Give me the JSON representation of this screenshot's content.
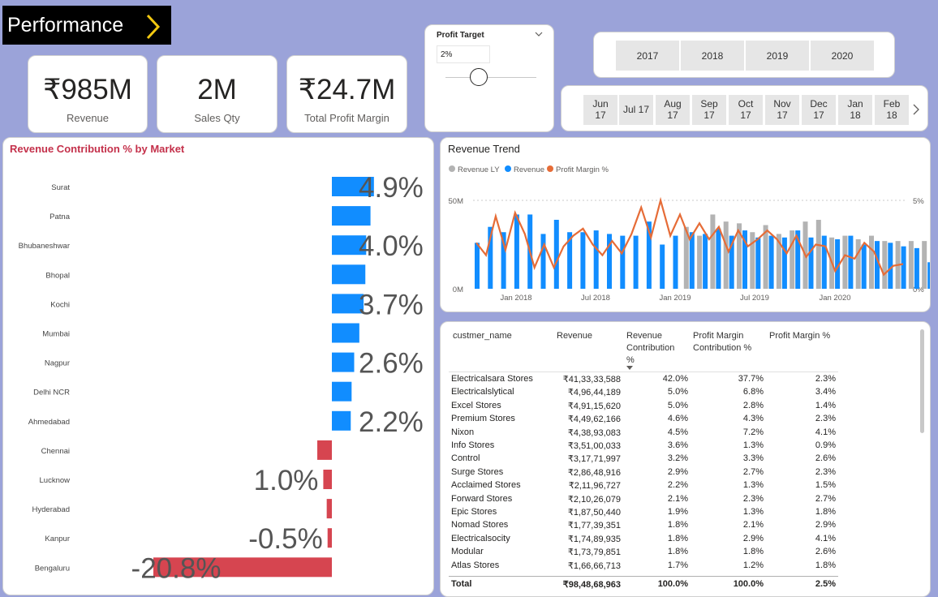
{
  "page": {
    "title": "Performance"
  },
  "kpis": [
    {
      "value": "₹985M",
      "label": "Revenue"
    },
    {
      "value": "2M",
      "label": "Sales Qty"
    },
    {
      "value": "₹24.7M",
      "label": "Total Profit Margin"
    }
  ],
  "profit_target": {
    "title": "Profit Target",
    "value": "2%",
    "slider_level": 0.37
  },
  "year_slicer": {
    "years": [
      "2017",
      "2018",
      "2019",
      "2020"
    ]
  },
  "month_slicer": {
    "months": [
      {
        "m": "Jun",
        "y": "17"
      },
      {
        "m": "Jul 17",
        "y": ""
      },
      {
        "m": "Aug",
        "y": "17"
      },
      {
        "m": "Sep",
        "y": "17"
      },
      {
        "m": "Oct",
        "y": "17"
      },
      {
        "m": "Nov",
        "y": "17"
      },
      {
        "m": "Dec",
        "y": "17"
      },
      {
        "m": "Jan",
        "y": "18"
      },
      {
        "m": "Feb",
        "y": "18"
      }
    ],
    "next_icon": "chevron-right-icon"
  },
  "colors": {
    "positive": "#118dff",
    "negative": "#d64550",
    "revenue_ly": "#b3b3b3",
    "profit_line": "#e66c37",
    "title_red": "#c4314b"
  },
  "market_chart": {
    "title": "Revenue Contribution % by Market",
    "type": "bar",
    "categories": [
      "Surat",
      "Patna",
      "Bhubaneshwar",
      "Bhopal",
      "Kochi",
      "Mumbai",
      "Nagpur",
      "Delhi NCR",
      "Ahmedabad",
      "Chennai",
      "Lucknow",
      "Hyderabad",
      "Kanpur",
      "Bengaluru"
    ],
    "values": [
      4.9,
      4.5,
      4.0,
      3.9,
      3.7,
      3.2,
      2.6,
      2.3,
      2.2,
      -1.7,
      -1.0,
      -0.6,
      -0.5,
      -20.8
    ],
    "labels": [
      "4.9%",
      "",
      "4.0%",
      "",
      "3.7%",
      "",
      "2.6%",
      "",
      "2.2%",
      "",
      "1.0%",
      "",
      "-0.5%",
      "-20.8%"
    ]
  },
  "trend_chart": {
    "title": "Revenue Trend",
    "legend": [
      "Revenue LY",
      "Revenue",
      "Profit Margin %"
    ],
    "y_left_ticks": [
      "50M",
      "0M"
    ],
    "y_right_ticks": [
      "5%",
      "0%"
    ],
    "x_ticks": [
      "Jan 2018",
      "Jul 2018",
      "Jan 2019",
      "Jul 2019",
      "Jan 2020"
    ],
    "chart_data": {
      "type": "bar",
      "ylim": [
        0,
        50
      ],
      "y2lim": [
        0,
        5
      ],
      "revenue": [
        26,
        35,
        32,
        42,
        42,
        31,
        39,
        32,
        32,
        33,
        31,
        30,
        30,
        38,
        25,
        30,
        32,
        31,
        34,
        30,
        33,
        29,
        30,
        29,
        33,
        29,
        30,
        28,
        30,
        25,
        27,
        26,
        24,
        23,
        15
      ],
      "revenue_ly": [
        0,
        0,
        0,
        0,
        0,
        0,
        0,
        0,
        0,
        0,
        0,
        0,
        0,
        0,
        0,
        0,
        35,
        30,
        42,
        38,
        37,
        32,
        36,
        31,
        33,
        38,
        39,
        29,
        30,
        28,
        30,
        27,
        27,
        27,
        27
      ],
      "profit_margin": [
        2.6,
        1.9,
        4.1,
        2.2,
        4.3,
        3.1,
        1.2,
        2.5,
        1.2,
        2.4,
        3.0,
        3.4,
        2.5,
        1.9,
        2.7,
        2.0,
        3.1,
        4.6,
        2.9,
        5.0,
        3.0,
        4.2,
        2.8,
        3.7,
        2.8,
        3.5,
        2.1,
        3.3,
        2.4,
        2.8,
        3.3,
        2.8,
        2.0,
        3.0,
        1.8,
        2.5,
        2.4,
        1.0,
        1.9,
        1.7,
        2.6,
        2.1,
        0.8,
        1.3,
        1.4
      ]
    }
  },
  "table": {
    "headers": [
      "custmer_name",
      "Revenue",
      "Revenue Contribution %",
      "Profit Margin Contribution %",
      "Profit Margin %"
    ],
    "rows": [
      [
        "Electricalsara Stores",
        "₹41,33,33,588",
        "42.0%",
        "37.7%",
        "2.3%"
      ],
      [
        "Electricalslytical",
        "₹4,96,44,189",
        "5.0%",
        "6.8%",
        "3.4%"
      ],
      [
        "Excel Stores",
        "₹4,91,15,620",
        "5.0%",
        "2.8%",
        "1.4%"
      ],
      [
        "Premium Stores",
        "₹4,49,62,166",
        "4.6%",
        "4.3%",
        "2.3%"
      ],
      [
        "Nixon",
        "₹4,38,93,083",
        "4.5%",
        "7.2%",
        "4.1%"
      ],
      [
        "Info Stores",
        "₹3,51,00,033",
        "3.6%",
        "1.3%",
        "0.9%"
      ],
      [
        "Control",
        "₹3,17,71,997",
        "3.2%",
        "3.3%",
        "2.6%"
      ],
      [
        "Surge Stores",
        "₹2,86,48,916",
        "2.9%",
        "2.7%",
        "2.3%"
      ],
      [
        "Acclaimed Stores",
        "₹2,11,96,727",
        "2.2%",
        "1.3%",
        "1.5%"
      ],
      [
        "Forward Stores",
        "₹2,10,26,079",
        "2.1%",
        "2.3%",
        "2.7%"
      ],
      [
        "Epic Stores",
        "₹1,87,50,440",
        "1.9%",
        "1.3%",
        "1.8%"
      ],
      [
        "Nomad Stores",
        "₹1,77,39,351",
        "1.8%",
        "2.1%",
        "2.9%"
      ],
      [
        "Electricalsocity",
        "₹1,74,89,935",
        "1.8%",
        "2.9%",
        "4.1%"
      ],
      [
        "Modular",
        "₹1,73,79,851",
        "1.8%",
        "1.8%",
        "2.6%"
      ],
      [
        "Atlas Stores",
        "₹1,66,66,713",
        "1.7%",
        "1.2%",
        "1.8%"
      ]
    ],
    "total": [
      "Total",
      "₹98,48,68,963",
      "100.0%",
      "100.0%",
      "2.5%"
    ]
  }
}
